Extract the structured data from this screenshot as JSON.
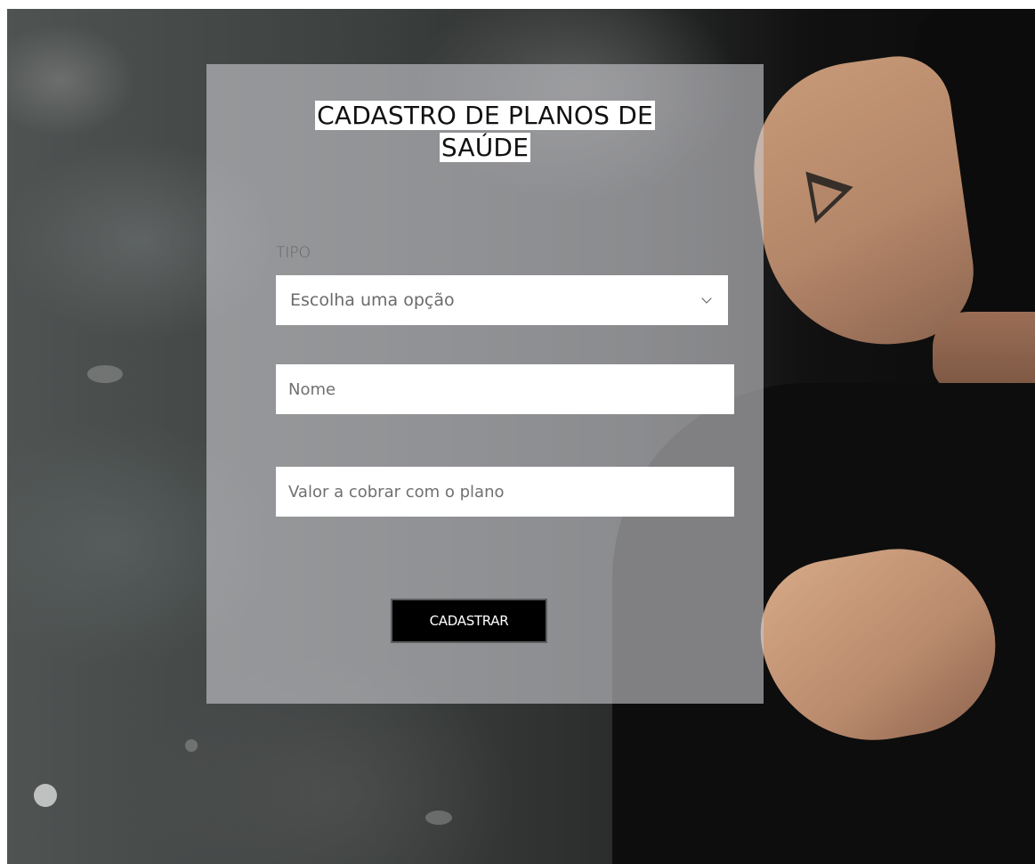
{
  "form": {
    "title_line1": "CADASTRO DE PLANOS DE",
    "title_line2": "SAÚDE",
    "type_label": "TIPO",
    "type_select": {
      "selected_text": "Escolha uma opção",
      "icon": "chevron-down-icon"
    },
    "name_input": {
      "value": "",
      "placeholder": "Nome"
    },
    "value_input": {
      "value": "",
      "placeholder": "Valor a cobrar com o plano"
    },
    "submit_label": "CADASTRAR"
  },
  "colors": {
    "card_overlay": "#c8c8cd",
    "button_bg": "#000000",
    "button_text": "#ffffff",
    "input_bg": "#ffffff"
  }
}
